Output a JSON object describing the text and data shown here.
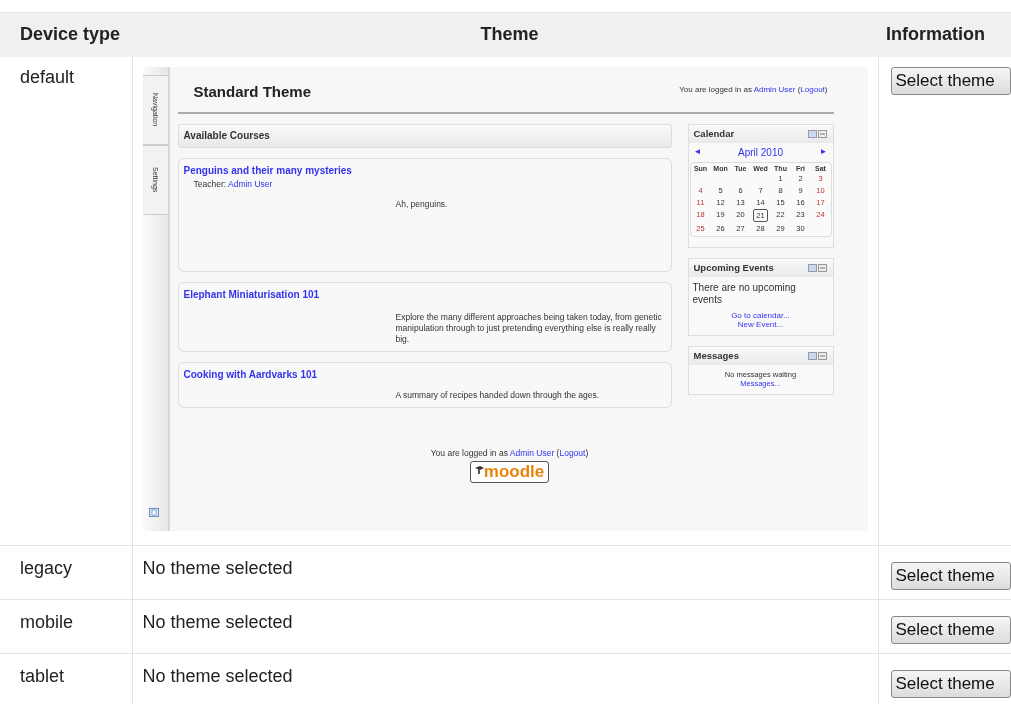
{
  "table": {
    "columns": [
      "Device type",
      "Theme",
      "Information"
    ],
    "rows": [
      {
        "device": "default",
        "kind": "preview",
        "button": "Select theme"
      },
      {
        "device": "legacy",
        "kind": "none",
        "theme_text": "No theme selected",
        "button": "Select theme"
      },
      {
        "device": "mobile",
        "kind": "none",
        "theme_text": "No theme selected",
        "button": "Select theme"
      },
      {
        "device": "tablet",
        "kind": "none",
        "theme_text": "No theme selected",
        "button": "Select theme"
      }
    ]
  },
  "preview": {
    "side_tabs": [
      "Navigation",
      "Settings"
    ],
    "title": "Standard Theme",
    "login": {
      "prefix": "You are logged in as",
      "user": "Admin User",
      "open": "(",
      "logout": "Logout",
      "close": ")"
    },
    "courses_heading": "Available Courses",
    "courses": [
      {
        "name": "Penguins and their many mysteries",
        "teacher_label": "Teacher:",
        "teacher": "Admin User",
        "summary": "Ah, penguins."
      },
      {
        "name": "Elephant Miniaturisation 101",
        "summary": "Explore the many different approaches being taken today, from genetic manipulation through to just pretending everything else is really really big."
      },
      {
        "name": "Cooking with Aardvarks 101",
        "summary": "A summary of recipes handed down through the ages."
      }
    ],
    "calendar": {
      "title": "Calendar",
      "prev": "◄",
      "month": "April 2010",
      "next": "►",
      "weekdays": [
        "Sun",
        "Mon",
        "Tue",
        "Wed",
        "Thu",
        "Fri",
        "Sat"
      ],
      "weeks": [
        [
          {
            "day": "1",
            "weekend": false,
            "today": false
          },
          {
            "day": "2",
            "weekend": false,
            "today": false
          },
          {
            "day": "3",
            "weekend": true,
            "today": false
          }
        ],
        [
          {
            "day": "4",
            "weekend": true,
            "today": false
          },
          {
            "day": "5",
            "weekend": false,
            "today": false
          },
          {
            "day": "6",
            "weekend": false,
            "today": false
          },
          {
            "day": "7",
            "weekend": false,
            "today": false
          },
          {
            "day": "8",
            "weekend": false,
            "today": false
          },
          {
            "day": "9",
            "weekend": false,
            "today": false
          },
          {
            "day": "10",
            "weekend": true,
            "today": false
          }
        ],
        [
          {
            "day": "11",
            "weekend": true,
            "today": false
          },
          {
            "day": "12",
            "weekend": false,
            "today": false
          },
          {
            "day": "13",
            "weekend": false,
            "today": false
          },
          {
            "day": "14",
            "weekend": false,
            "today": false
          },
          {
            "day": "15",
            "weekend": false,
            "today": false
          },
          {
            "day": "16",
            "weekend": false,
            "today": false
          },
          {
            "day": "17",
            "weekend": true,
            "today": false
          }
        ],
        [
          {
            "day": "18",
            "weekend": true,
            "today": false
          },
          {
            "day": "19",
            "weekend": false,
            "today": false
          },
          {
            "day": "20",
            "weekend": false,
            "today": false
          },
          {
            "day": "21",
            "weekend": false,
            "today": true
          },
          {
            "day": "22",
            "weekend": false,
            "today": false
          },
          {
            "day": "23",
            "weekend": false,
            "today": false
          },
          {
            "day": "24",
            "weekend": true,
            "today": false
          }
        ],
        [
          {
            "day": "25",
            "weekend": true,
            "today": false
          },
          {
            "day": "26",
            "weekend": false,
            "today": false
          },
          {
            "day": "27",
            "weekend": false,
            "today": false
          },
          {
            "day": "28",
            "weekend": false,
            "today": false
          },
          {
            "day": "29",
            "weekend": false,
            "today": false
          },
          {
            "day": "30",
            "weekend": false,
            "today": false
          }
        ]
      ]
    },
    "events": {
      "title": "Upcoming Events",
      "text": "There are no upcoming events",
      "links": [
        "Go to calendar...",
        "New Event..."
      ]
    },
    "messages": {
      "title": "Messages",
      "text": "No messages waiting",
      "link": "Messages..."
    },
    "footer_login": {
      "prefix": "You are logged in as",
      "user": "Admin User",
      "open": "(",
      "logout": "Logout",
      "close": ")"
    },
    "logo": "moodle"
  }
}
